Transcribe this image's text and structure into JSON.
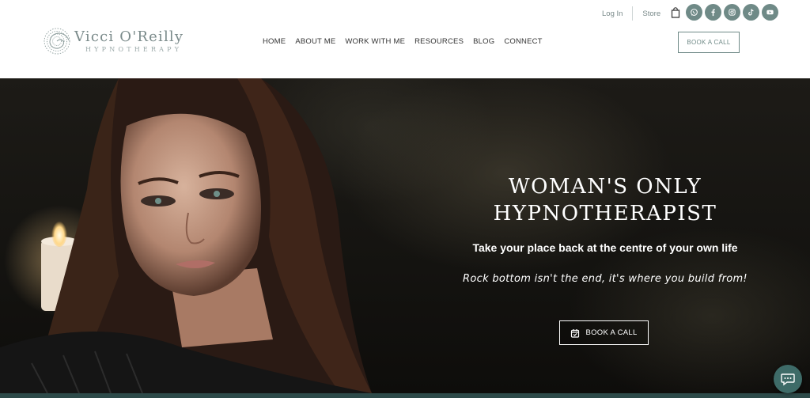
{
  "brand": {
    "name": "Vicci O'Reilly",
    "tagline": "Hypnotherapy"
  },
  "nav": [
    {
      "label": "HOME"
    },
    {
      "label": "ABOUT ME"
    },
    {
      "label": "WORK WITH ME"
    },
    {
      "label": "RESOURCES"
    },
    {
      "label": "BLOG"
    },
    {
      "label": "CONNECT"
    }
  ],
  "util": {
    "login": "Log In",
    "store": "Store"
  },
  "social": [
    "whatsapp-icon",
    "facebook-icon",
    "instagram-icon",
    "tiktok-icon",
    "youtube-icon"
  ],
  "header_cta": "BOOK A CALL",
  "hero": {
    "title_line1": "WOMAN'S ONLY",
    "title_line2": "HYPNOTHERAPIST",
    "subtitle": "Take your place back at the centre of your own life",
    "quote": "Rock bottom isn't the end, it's where you build from!",
    "cta": "BOOK A CALL"
  },
  "colors": {
    "accent": "#6f8a87",
    "chat": "#3e6b68",
    "footer_band": "#2d4a49"
  }
}
